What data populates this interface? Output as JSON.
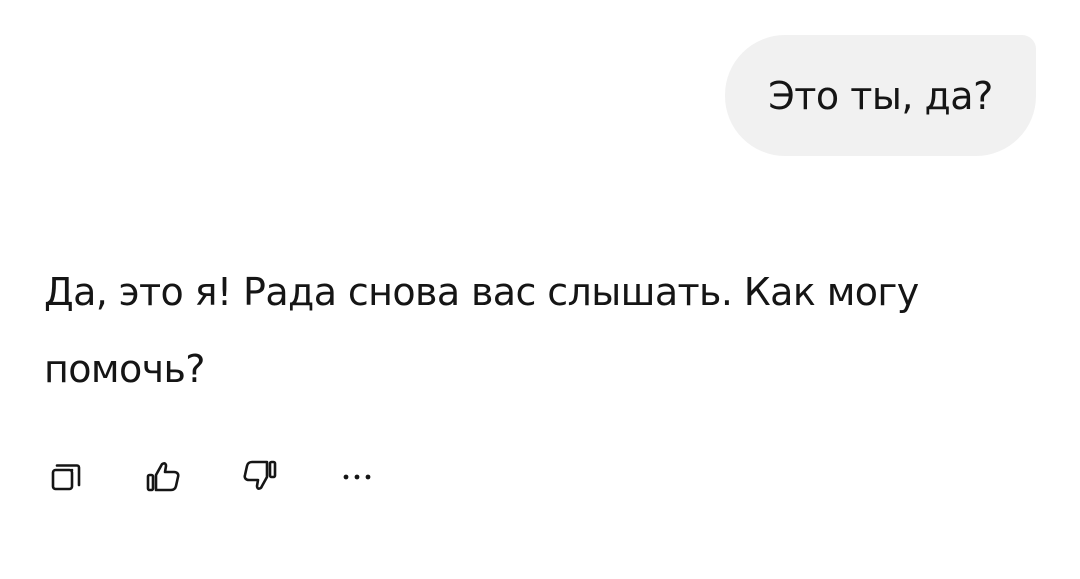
{
  "conversation": {
    "user_message": "Это ты, да?",
    "assistant_message": "Да, это я! Рада снова вас слышать. Как могу помочь?"
  },
  "actions": [
    {
      "icon": "copy-icon"
    },
    {
      "icon": "thumbs-up-icon"
    },
    {
      "icon": "thumbs-down-icon"
    },
    {
      "icon": "more-icon"
    }
  ],
  "colors": {
    "text": "#151515",
    "user_bubble": "#f1f1f1",
    "background": "#ffffff"
  }
}
